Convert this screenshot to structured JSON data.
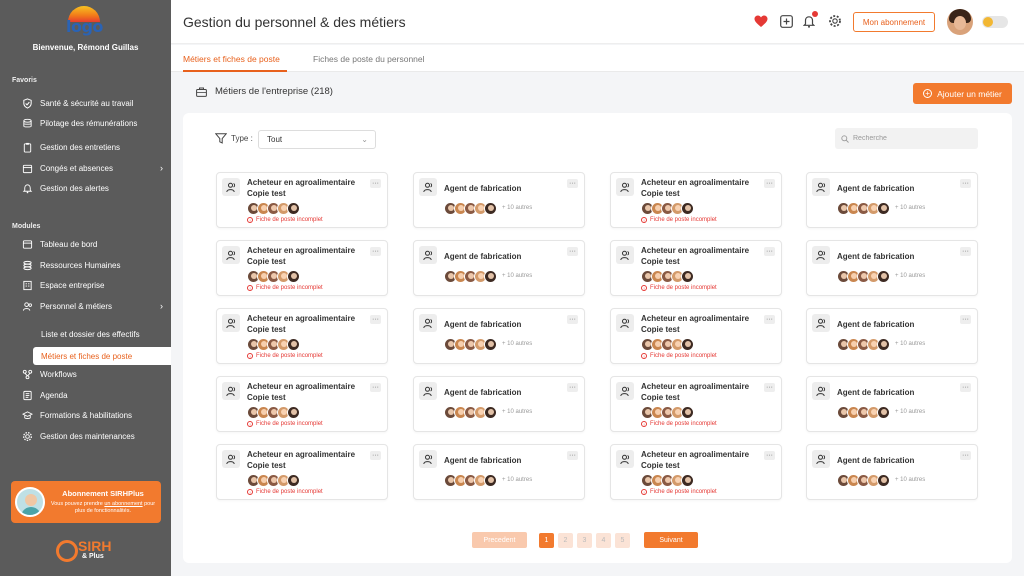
{
  "sidebar": {
    "welcome": "Bienvenue, Rémond Guillas",
    "logo_text": "logo",
    "favoris_title": "Favoris",
    "favoris": [
      {
        "label": "Santé & sécurité au travail",
        "icon": "shield-check-icon"
      },
      {
        "label": "Pilotage des rémunérations",
        "icon": "database-icon"
      },
      {
        "label": "Gestion des entretiens",
        "icon": "clipboard-icon"
      },
      {
        "label": "Congés et absences",
        "icon": "calendar-icon"
      },
      {
        "label": "Gestion des alertes",
        "icon": "bell-icon"
      }
    ],
    "modules_title": "Modules",
    "modules": [
      {
        "label": "Tableau de bord",
        "icon": "dashboard-icon"
      },
      {
        "label": "Ressources Humaines",
        "icon": "stack-icon"
      },
      {
        "label": "Espace entreprise",
        "icon": "building-icon"
      },
      {
        "label": "Personnel & métiers",
        "icon": "users-icon"
      }
    ],
    "submodules": [
      {
        "label": "Liste et dossier des effectifs"
      },
      {
        "label": "Métiers et fiches de poste"
      }
    ],
    "modules2": [
      {
        "label": "Workflows",
        "icon": "workflow-icon"
      },
      {
        "label": "Agenda",
        "icon": "agenda-icon"
      },
      {
        "label": "Formations & habilitations",
        "icon": "graduation-icon"
      },
      {
        "label": "Gestion des maintenances",
        "icon": "gear-icon"
      }
    ],
    "promo": {
      "title": "Abonnement SIRHPlus",
      "text_before": "Vous pouvez prendre ",
      "link": "un abonnement",
      "text_after": " pour plus de fonctionnalités."
    },
    "brand": {
      "name": "SIRH",
      "suffix": "& Plus"
    }
  },
  "header": {
    "title": "Gestion du personnel & des métiers",
    "subscription_btn": "Mon abonnement"
  },
  "tabs": [
    {
      "label": "Métiers et fiches de poste"
    },
    {
      "label": "Fiches de poste du personnel"
    }
  ],
  "section": {
    "title": "Métiers de l'entreprise (218)",
    "add_btn": "Ajouter un métier"
  },
  "filter": {
    "label": "Type :",
    "value": "Tout",
    "search_placeholder": "Recherche"
  },
  "cards": {
    "a": {
      "line1": "Acheteur en agroalimentaire",
      "line2": "Copie test",
      "warning": "Fiche de poste incomplet"
    },
    "b": {
      "title": "Agent de fabrication",
      "more": "+ 10 autres"
    }
  },
  "avatar_colors": [
    "#6b4a3a",
    "#c9864f",
    "#8a5a44",
    "#d39a6a",
    "#3d2a22"
  ],
  "pagination": {
    "prev": "Precedent",
    "pages": [
      "1",
      "2",
      "3",
      "4",
      "5"
    ],
    "next": "Suivant"
  },
  "colors": {
    "accent": "#f27a2e",
    "sidebar": "#5b5b5b",
    "warning": "#e53935"
  }
}
